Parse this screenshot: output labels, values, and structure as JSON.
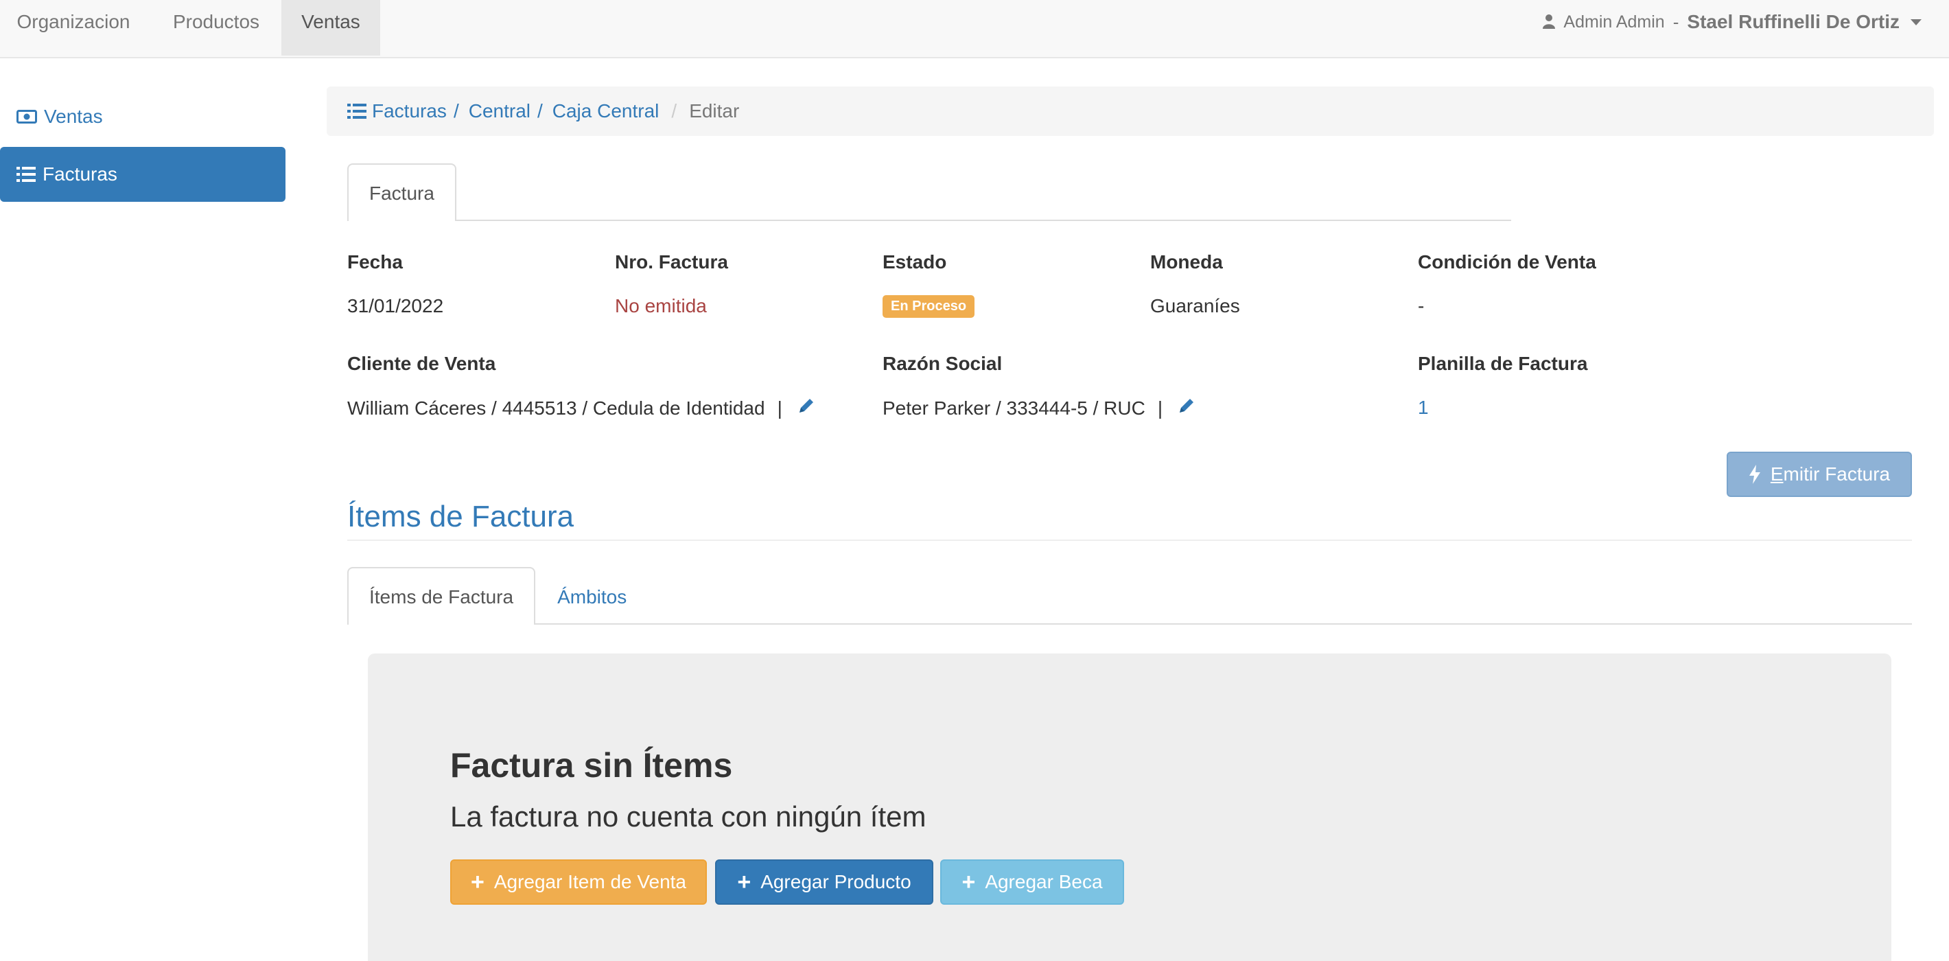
{
  "navbar": {
    "items": [
      {
        "label": "Organizacion"
      },
      {
        "label": "Productos"
      },
      {
        "label": "Ventas"
      }
    ],
    "user_name": "Admin Admin",
    "separator": "-",
    "org_name": "Stael Ruffinelli De Ortiz"
  },
  "sidebar": {
    "items": [
      {
        "label": "Ventas",
        "icon": "money-icon"
      },
      {
        "label": "Facturas",
        "icon": "list-icon"
      }
    ]
  },
  "breadcrumb": {
    "items": [
      "Facturas",
      "Central",
      "Caja Central"
    ],
    "current": "Editar"
  },
  "top_tabs": [
    {
      "label": "Factura"
    }
  ],
  "invoice": {
    "fecha": {
      "label": "Fecha",
      "value": "31/01/2022"
    },
    "nro_factura": {
      "label": "Nro. Factura",
      "value": "No emitida"
    },
    "estado": {
      "label": "Estado",
      "value": "En Proceso"
    },
    "moneda": {
      "label": "Moneda",
      "value": "Guaraníes"
    },
    "condicion": {
      "label": "Condición de Venta",
      "value": "-"
    },
    "cliente": {
      "label": "Cliente de Venta",
      "value": "William Cáceres / 4445513 / Cedula de Identidad",
      "pipe": "|"
    },
    "razon_social": {
      "label": "Razón Social",
      "value": "Peter Parker / 333444-5 / RUC",
      "pipe": "|"
    },
    "planilla": {
      "label": "Planilla de Factura",
      "value": "1"
    }
  },
  "emit_button": {
    "first_letter": "E",
    "rest": "mitir Factura"
  },
  "items_section": {
    "title": "Ítems de Factura",
    "tabs": [
      {
        "label": "Ítems de Factura"
      },
      {
        "label": "Ámbitos"
      }
    ]
  },
  "empty_state": {
    "title": "Factura sin Ítems",
    "subtitle": "La factura no cuenta con ningún ítem",
    "buttons": [
      {
        "label": "Agregar Item de Venta"
      },
      {
        "label": "Agregar Producto"
      },
      {
        "label": "Agregar Beca"
      }
    ]
  },
  "colors": {
    "primary": "#337ab7",
    "warning": "#f0ad4e",
    "info": "#7cc3e3",
    "danger": "#a94442"
  }
}
